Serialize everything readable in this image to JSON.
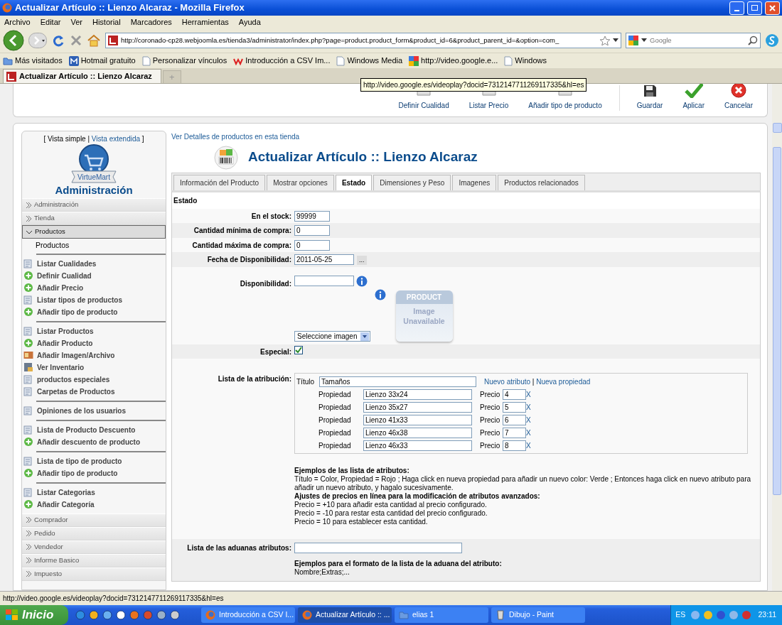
{
  "window": {
    "title": "Actualizar Artículo :: Lienzo Alcaraz - Mozilla Firefox"
  },
  "menu": [
    "Archivo",
    "Editar",
    "Ver",
    "Historial",
    "Marcadores",
    "Herramientas",
    "Ayuda"
  ],
  "address": {
    "url": "http://coronado-cp28.webjoomla.es/tienda3/administrator/index.php?page=product.product_form&product_id=6&product_parent_id=&option=com_",
    "search_placeholder": "Google"
  },
  "bookmarks": [
    {
      "label": "Más visitados",
      "kind": "folder"
    },
    {
      "label": "Hotmail gratuito",
      "kind": "tile"
    },
    {
      "label": "Personalizar vínculos",
      "kind": "page"
    },
    {
      "label": "Introducción a CSV Im...",
      "kind": "mark"
    },
    {
      "label": "Windows Media",
      "kind": "page"
    },
    {
      "label": "http://video.google.e...",
      "kind": "grid"
    },
    {
      "label": "Windows",
      "kind": "page"
    }
  ],
  "browser_tabs": [
    {
      "label": "Actualizar Artículo :: Lienzo Alcaraz",
      "selected": true
    }
  ],
  "new_tab": "+",
  "tooltip": "http://video.google.es/videoplay?docid=7312147711269117335&hl=es",
  "toolbar": [
    {
      "label": "Definir Cualidad",
      "kind": "cut"
    },
    {
      "label": "Listar Precio",
      "kind": "cut"
    },
    {
      "label": "Añadir tipo de producto",
      "kind": "cut"
    },
    {
      "label": "Guardar",
      "kind": "save"
    },
    {
      "label": "Aplicar",
      "kind": "apply"
    },
    {
      "label": "Cancelar",
      "kind": "cancel"
    }
  ],
  "sidebar": {
    "view_toggle": [
      {
        "text": "[ Vista simple |",
        "kind": "text"
      },
      {
        "text": "Vista extendida",
        "kind": "link"
      },
      {
        "text": "]",
        "kind": "text"
      }
    ],
    "logo_label": "VirtueMart",
    "heading": "Administración",
    "sections": [
      {
        "label": "Administración",
        "expanded": false
      },
      {
        "label": "Tienda",
        "expanded": false
      },
      {
        "label": "Productos",
        "expanded": true,
        "title": "Productos",
        "groups": [
          [
            {
              "label": "Listar Cualidades",
              "kind": "list"
            },
            {
              "label": "Definir Cualidad",
              "kind": "add"
            },
            {
              "label": "Añadir Precio",
              "kind": "add"
            },
            {
              "label": "Listar tipos de productos",
              "kind": "list"
            },
            {
              "label": "Añadir tipo de producto",
              "kind": "add"
            }
          ],
          [
            {
              "label": "Listar Productos",
              "kind": "list"
            },
            {
              "label": "Añadir Producto",
              "kind": "add"
            },
            {
              "label": "Añadir Imagen/Archivo",
              "kind": "image"
            },
            {
              "label": "Ver Inventario",
              "kind": "inventory"
            },
            {
              "label": "productos especiales",
              "kind": "list"
            },
            {
              "label": "Carpetas de Productos",
              "kind": "list"
            }
          ],
          [
            {
              "label": "Opiniones de los usuarios",
              "kind": "list"
            }
          ],
          [
            {
              "label": "Lista de Producto Descuento",
              "kind": "list"
            },
            {
              "label": "Añadir descuento de producto",
              "kind": "add"
            }
          ],
          [
            {
              "label": "Lista de tipo de producto",
              "kind": "list"
            },
            {
              "label": "Añadir tipo de producto",
              "kind": "add"
            }
          ],
          [
            {
              "label": "Listar Categorias",
              "kind": "list"
            },
            {
              "label": "Añadir Categoría",
              "kind": "add"
            }
          ]
        ]
      },
      {
        "label": "Comprador",
        "expanded": false
      },
      {
        "label": "Pedido",
        "expanded": false
      },
      {
        "label": "Vendedor",
        "expanded": false
      },
      {
        "label": "Informe Basico",
        "expanded": false
      },
      {
        "label": "Impuesto",
        "expanded": false
      }
    ]
  },
  "main": {
    "top_link": "Ver Detalles de productos en esta tienda",
    "title": "Actualizar Artículo :: Lienzo Alcaraz",
    "tabs": [
      {
        "label": "Información del Producto",
        "selected": false
      },
      {
        "label": "Mostrar opciones",
        "selected": false
      },
      {
        "label": "Estado",
        "selected": true
      },
      {
        "label": "Dimensiones y Peso",
        "selected": false
      },
      {
        "label": "Imagenes",
        "selected": false
      },
      {
        "label": "Productos relacionados",
        "selected": false
      }
    ],
    "section_heading": "Estado",
    "fields": [
      {
        "kind": "text",
        "label": "En el stock:",
        "value": "99999"
      },
      {
        "kind": "text",
        "label": "Cantidad mínima de compra:",
        "value": "0"
      },
      {
        "kind": "text",
        "label": "Cantidad máxima de compra:",
        "value": "0"
      },
      {
        "kind": "date",
        "label": "Fecha de Disponibilidad:",
        "value": "2011-05-25",
        "button": "..."
      },
      {
        "kind": "availability",
        "label": "Disponibilidad:",
        "image_header": "PRODUCT",
        "image_caption": "Image Unavailable",
        "select": "Seleccione imagen"
      },
      {
        "kind": "checkbox",
        "label": "Especial:",
        "checked": true
      },
      {
        "kind": "attributes",
        "label": "Lista de la atribución:",
        "title_label": "Título",
        "title_value": "Tamaños",
        "links": [
          "Nuevo atributo",
          "Nueva propiedad"
        ],
        "separator": "|",
        "rows": [
          {
            "label": "Propiedad",
            "value": "Lienzo 33x24",
            "price_label": "Precio",
            "price": "4",
            "remove": "X"
          },
          {
            "label": "Propiedad",
            "value": "Lienzo 35x27",
            "price_label": "Precio",
            "price": "5",
            "remove": "X"
          },
          {
            "label": "Propiedad",
            "value": "Lienzo 41x33",
            "price_label": "Precio",
            "price": "6",
            "remove": "X"
          },
          {
            "label": "Propiedad",
            "value": "Lienzo 46x38",
            "price_label": "Precio",
            "price": "7",
            "remove": "X"
          },
          {
            "label": "Propiedad",
            "value": "Lienzo 46x33",
            "price_label": "Precio",
            "price": "8",
            "remove": "X"
          }
        ],
        "notes": [
          {
            "kind": "heading",
            "text": "Ejemplos de las lista de atributos:"
          },
          {
            "kind": "line",
            "text": "Título = Color, Propiedad = Rojo ; Haga click en nueva propiedad para añadir un nuevo color: Verde ; Entonces haga click en nuevo atributo para añadir un nuevo atributo, y hagalo sucesivamente."
          },
          {
            "kind": "heading",
            "text": "Ajustes de precios en línea para la modificación de atributos avanzados:"
          },
          {
            "kind": "line",
            "text": "Precio = +10 para añadir esta cantidad al precio configurado."
          },
          {
            "kind": "line",
            "text": "Precio = -10 para restar esta cantidad del precio configurado."
          },
          {
            "kind": "line",
            "text": "Precio = 10 para establecer esta cantidad."
          }
        ]
      },
      {
        "kind": "custom",
        "label": "Lista de las aduanas atributos:",
        "notes": [
          {
            "kind": "heading",
            "text": "Ejemplos para el formato de la lista de la aduana del atributo:"
          },
          {
            "kind": "line",
            "text": "Nombre;Extras;..."
          }
        ]
      }
    ]
  },
  "status_bar": "http://video.google.es/videoplay?docid=7312147711269117335&hl=es",
  "taskbar": {
    "start": "Inicio",
    "tasks": [
      {
        "label": "Introducción a CSV I...",
        "kind": "browser",
        "selected": false
      },
      {
        "label": "Actualizar Artículo :: ...",
        "kind": "browser",
        "selected": true
      },
      {
        "label": "elias 1",
        "kind": "folder",
        "selected": false
      },
      {
        "label": "Dibujo - Paint",
        "kind": "paint",
        "selected": false
      }
    ],
    "language": "ES",
    "clock": "23:11"
  }
}
